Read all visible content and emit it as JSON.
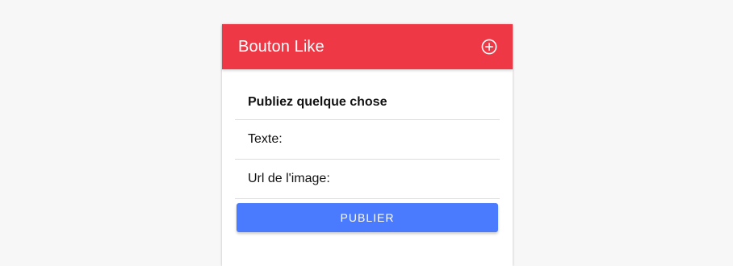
{
  "header": {
    "title": "Bouton Like",
    "add_icon": "plus-circle-icon"
  },
  "form": {
    "heading": "Publiez quelque chose",
    "text_label": "Texte:",
    "text_value": "",
    "image_url_label": "Url de l'image:",
    "image_url_value": "",
    "submit_label": "PUBLIER"
  },
  "colors": {
    "header": "#ee3846",
    "button": "#4a7bfe"
  }
}
